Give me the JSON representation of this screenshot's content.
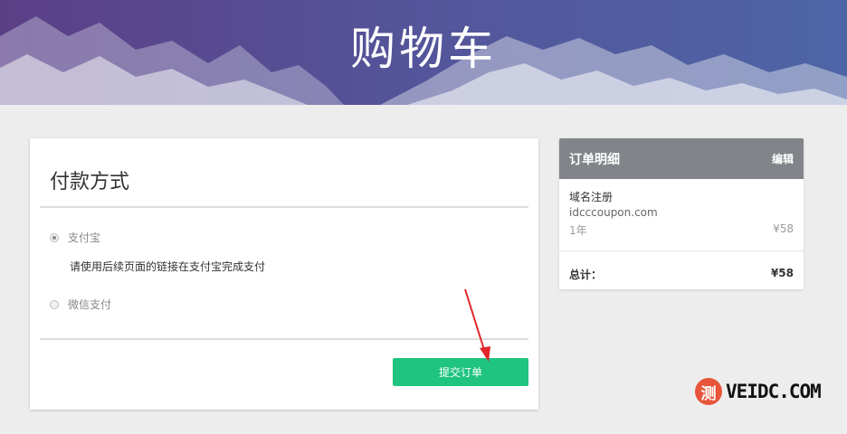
{
  "header": {
    "title": "购物车"
  },
  "payment": {
    "title": "付款方式",
    "options": [
      {
        "label": "支付宝",
        "selected": true
      },
      {
        "label": "微信支付",
        "selected": false
      }
    ],
    "hint": "请使用后续页面的链接在支付宝完成支付",
    "submit_label": "提交订单"
  },
  "summary": {
    "title": "订单明细",
    "edit_label": "编辑",
    "item": {
      "name": "域名注册",
      "domain": "idcccoupon.com",
      "period": "1年",
      "price": "¥58"
    },
    "total_label": "总计：",
    "total_value": "¥58"
  },
  "watermark": {
    "badge": "测",
    "text": "VEIDC.COM"
  },
  "colors": {
    "submit": "#1ec480",
    "summary_header": "#818589",
    "arrow": "#e0262b",
    "watermark": "#e8553b"
  }
}
